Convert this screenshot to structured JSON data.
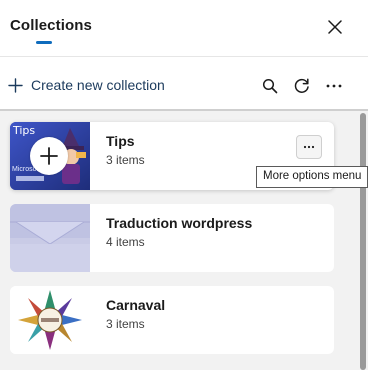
{
  "header": {
    "title": "Collections",
    "close_icon": "close-icon"
  },
  "toolbar": {
    "create_label": "Create new collection",
    "icons": [
      "plus-icon",
      "search-icon",
      "refresh-icon",
      "more-horizontal-icon"
    ]
  },
  "collections": [
    {
      "title": "Tips",
      "count": "3 items",
      "thumb_text": "Tips",
      "thumb_caption": "Microsoft"
    },
    {
      "title": "Traduction wordpress",
      "count": "4 items"
    },
    {
      "title": "Carnaval",
      "count": "3 items"
    }
  ],
  "tooltip": {
    "text": "More options menu"
  },
  "colors": {
    "accent": "#0f6cbd",
    "list_bg": "#f2f2f2",
    "card_bg": "#ffffff"
  }
}
